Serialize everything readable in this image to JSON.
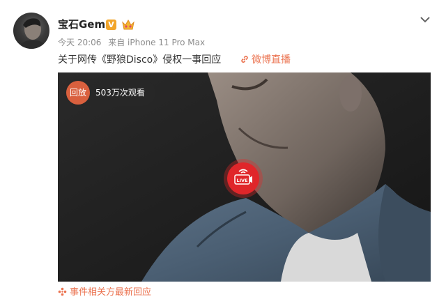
{
  "post": {
    "username": "宝石Gem",
    "badge_v": "V",
    "time": "今天 20:06",
    "source": "来自 iPhone 11 Pro Max",
    "text": "关于网传《野狼Disco》侵权一事回应",
    "live_link": "微博直播"
  },
  "video": {
    "replay_label": "回放",
    "view_count": "503万次观看",
    "live_label": "LIVE"
  },
  "footer": {
    "text": "事件相关方最新回应"
  },
  "icons": {
    "avatar": "avatar-image",
    "v_badge": "verified-v-icon",
    "crown": "fan-crown-icon",
    "chevron": "chevron-down-icon",
    "link": "link-icon",
    "live": "live-camera-icon",
    "event": "event-sparkle-icon"
  },
  "colors": {
    "accent": "#eb7350",
    "live_red": "#e0262a",
    "replay_orange": "#d9603e",
    "badge_gold": "#f2a52a"
  }
}
